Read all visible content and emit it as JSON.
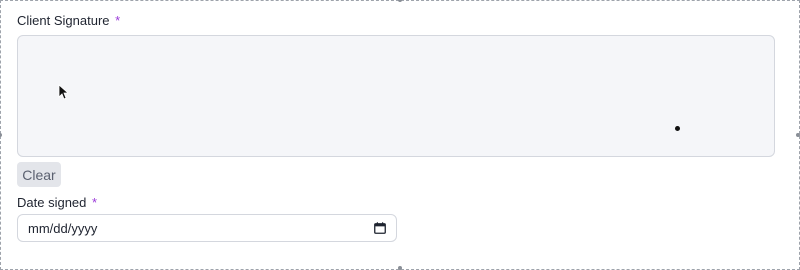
{
  "signature": {
    "label": "Client Signature",
    "required_mark": "*",
    "clear_label": "Clear"
  },
  "date": {
    "label": "Date signed",
    "required_mark": "*",
    "value": "mm/dd/yyyy"
  },
  "icons": {
    "cursor": "cursor-arrow-icon",
    "calendar": "calendar-icon"
  },
  "colors": {
    "required": "#9b3bd9",
    "pad_background": "#f5f6f9",
    "button_background": "#e3e5ea"
  }
}
